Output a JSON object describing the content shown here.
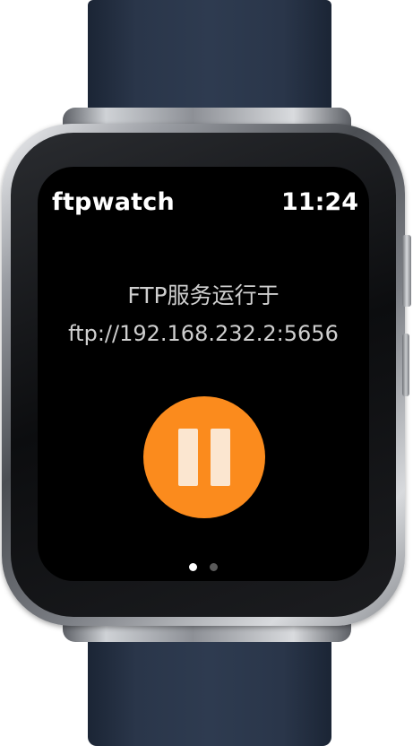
{
  "app": {
    "title": "ftpwatch",
    "time": "11:24"
  },
  "status": {
    "label": "FTP服务运行于",
    "url": "ftp://192.168.232.2:5656"
  },
  "controls": {
    "pause_icon": "pause-icon",
    "pause_color": "#fb8b1d"
  },
  "pager": {
    "count": 2,
    "active": 0
  }
}
